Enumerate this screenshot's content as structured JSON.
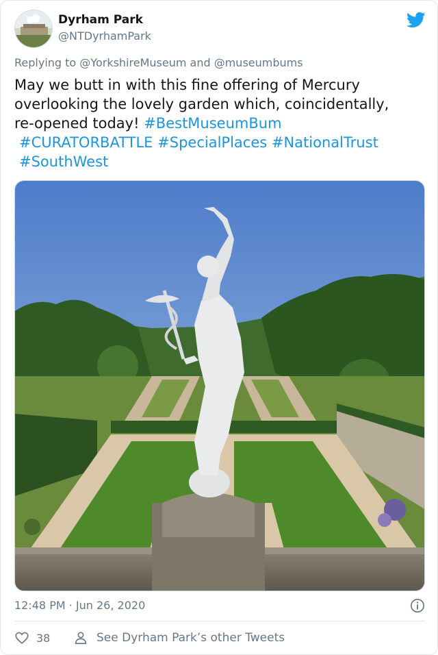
{
  "account": {
    "name": "Dyrham Park",
    "handle": "@NTDyrhamPark"
  },
  "reply": {
    "prefix": "Replying to",
    "user1": "@YorkshireMuseum",
    "conjunction": "and",
    "user2": "@museumbums"
  },
  "tweet": {
    "line1": "May we butt in with this fine offering of Mercury",
    "line2": "overlooking the lovely garden which, coincidentally,",
    "line3_text": "re-opened today! ",
    "hashtags": [
      "#BestMuseumBum",
      "#CURATORBATTLE",
      "#SpecialPlaces",
      "#NationalTrust",
      "#SouthWest"
    ]
  },
  "photo": {
    "alt": "Mercury statue overlooking garden"
  },
  "footer": {
    "timestamp": "12:48 PM · Jun 26, 2020",
    "like_count": "38",
    "other_tweets_label": "See Dyrham Park’s other Tweets"
  },
  "icons": {
    "brand": "twitter-bird-icon",
    "info": "info-icon",
    "like": "heart-icon",
    "profile": "person-icon"
  },
  "colors": {
    "link": "#1b95e0",
    "muted": "#657786",
    "brand": "#1da1f2"
  }
}
